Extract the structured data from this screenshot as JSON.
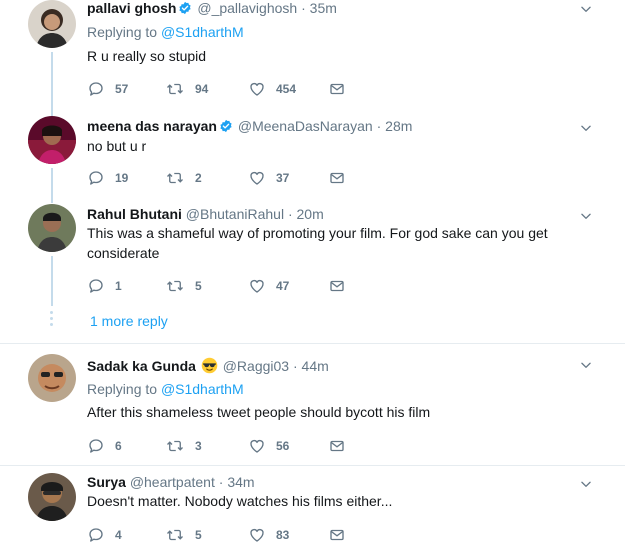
{
  "tweets": [
    {
      "name": "pallavi ghosh",
      "verified": true,
      "handle": "@_pallavighosh",
      "time": "35m",
      "replying_label": "Replying to",
      "replying_to": "@S1dharthM",
      "text": "R u really so stupid",
      "replies": "57",
      "retweets": "94",
      "likes": "454"
    },
    {
      "name": "meena das narayan",
      "verified": true,
      "handle": "@MeenaDasNarayan",
      "time": "28m",
      "text": "no but u r",
      "replies": "19",
      "retweets": "2",
      "likes": "37"
    },
    {
      "name": "Rahul Bhutani",
      "handle": "@BhutaniRahul",
      "time": "20m",
      "text": "This was a shameful way of promoting your film. For god sake can you get considerate",
      "replies": "1",
      "retweets": "5",
      "likes": "47"
    },
    {
      "name": "Sadak ka Gunda",
      "emoji": "sunglasses-emoji",
      "handle": "@Raggi03",
      "time": "44m",
      "replying_label": "Replying to",
      "replying_to": "@S1dharthM",
      "text": "After this shameless tweet people should bycott his film",
      "replies": "6",
      "retweets": "3",
      "likes": "56"
    },
    {
      "name": "Surya",
      "handle": "@heartpatent",
      "time": "34m",
      "text": "Doesn't matter. Nobody watches his films either...",
      "replies": "4",
      "retweets": "5",
      "likes": "83"
    }
  ],
  "more_reply": "1 more reply",
  "separator": "·",
  "icons": [
    "reply-icon",
    "retweet-icon",
    "like-icon",
    "dm-icon",
    "caret-down-icon",
    "verified-badge-icon"
  ],
  "colors": {
    "link": "#1da1f2",
    "muted": "#657786",
    "thread_line": "#c4dbeb",
    "divider": "#e6ecf0"
  }
}
